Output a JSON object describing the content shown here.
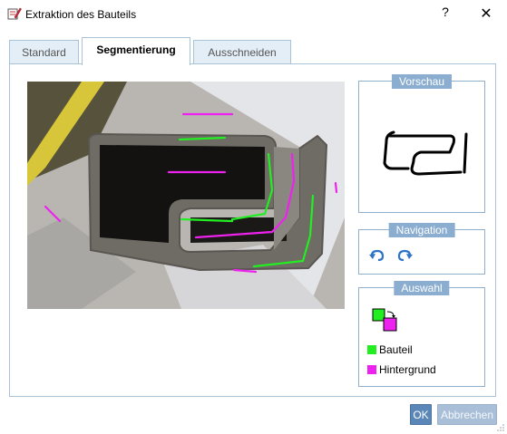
{
  "window": {
    "title": "Extraktion des Bauteils",
    "help_label": "?",
    "close_label": "✕"
  },
  "tabs": [
    {
      "label": "Standard",
      "active": false
    },
    {
      "label": "Segmentierung",
      "active": true
    },
    {
      "label": "Ausschneiden",
      "active": false
    }
  ],
  "preview": {
    "title": "Vorschau"
  },
  "navigation": {
    "title": "Navigation",
    "undo_icon": "undo-icon",
    "redo_icon": "redo-icon"
  },
  "selection": {
    "title": "Auswahl",
    "swap_icon": "swap-colors-icon",
    "items": [
      {
        "label": "Bauteil",
        "color": "#22ee22"
      },
      {
        "label": "Hintergrund",
        "color": "#ee22ee"
      }
    ]
  },
  "buttons": {
    "ok": "OK",
    "cancel": "Abbrechen"
  },
  "colors": {
    "accent": "#8aadd0",
    "foreground": "#22ee22",
    "background": "#ee22ee"
  }
}
